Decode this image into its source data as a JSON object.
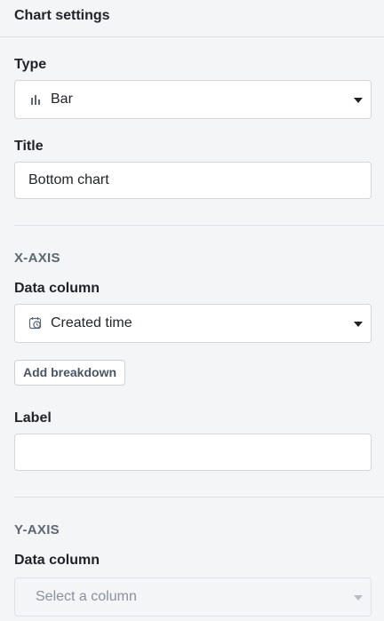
{
  "panel": {
    "title": "Chart settings"
  },
  "type_field": {
    "label": "Type",
    "value": "Bar",
    "icon": "bar-chart-icon"
  },
  "title_field": {
    "label": "Title",
    "value": "Bottom chart"
  },
  "x_axis": {
    "section_title": "X-AXIS",
    "data_column_label": "Data column",
    "data_column_value": "Created time",
    "data_column_icon": "clock-calendar-icon",
    "add_breakdown_label": "Add breakdown",
    "label_label": "Label",
    "label_value": ""
  },
  "y_axis": {
    "section_title": "Y-AXIS",
    "data_column_label": "Data column",
    "data_column_placeholder": "Select a column"
  }
}
